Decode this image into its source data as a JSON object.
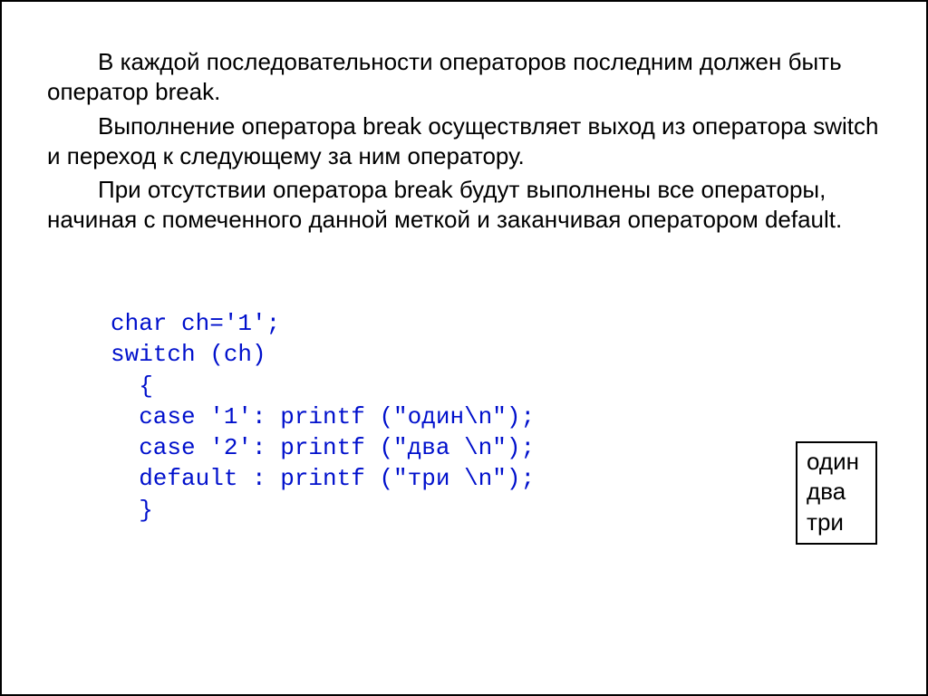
{
  "paragraphs": [
    "В каждой последовательности операторов последним должен быть оператор break.",
    "Выполнение оператора break осуществляет выход из оператора switch и переход к следующему за ним оператору.",
    "При отсутствии оператора break будут выполнены все операторы, начиная с помеченного данной меткой и заканчивая оператором default."
  ],
  "code_lines": [
    "char ch='1';",
    "switch (ch)",
    "  {",
    "  case '1': printf (\"один\\n\");",
    "  case '2': printf (\"два \\n\");",
    "  default : printf (\"три \\n\");",
    "  }"
  ],
  "output_lines": [
    "один",
    "два",
    "три"
  ]
}
